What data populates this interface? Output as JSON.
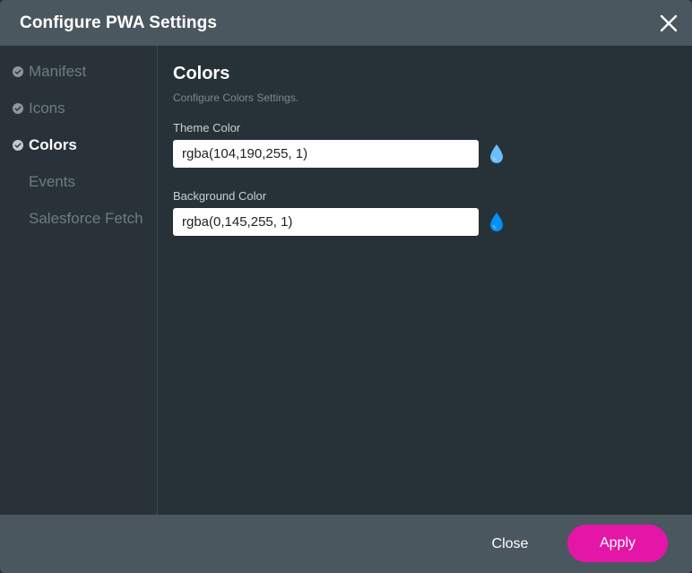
{
  "dialog": {
    "title": "Configure PWA Settings",
    "close_icon": "close-icon"
  },
  "sidebar": {
    "items": [
      {
        "label": "Manifest",
        "checked": true,
        "active": false
      },
      {
        "label": "Icons",
        "checked": true,
        "active": false
      },
      {
        "label": "Colors",
        "checked": true,
        "active": true
      },
      {
        "label": "Events",
        "checked": false,
        "active": false
      },
      {
        "label": "Salesforce Fetch",
        "checked": false,
        "active": false
      }
    ]
  },
  "main": {
    "heading": "Colors",
    "subtitle": "Configure Colors Settings.",
    "fields": [
      {
        "label": "Theme Color",
        "value": "rgba(104,190,255, 1)",
        "swatch_color": "#68beff",
        "icon": "color-drop-icon"
      },
      {
        "label": "Background Color",
        "value": "rgba(0,145,255, 1)",
        "swatch_color": "#0091ff",
        "icon": "color-drop-icon"
      }
    ]
  },
  "footer": {
    "close_label": "Close",
    "apply_label": "Apply"
  },
  "colors": {
    "header_bg": "#4a575e",
    "body_bg": "#273138",
    "accent": "#e416a8"
  }
}
